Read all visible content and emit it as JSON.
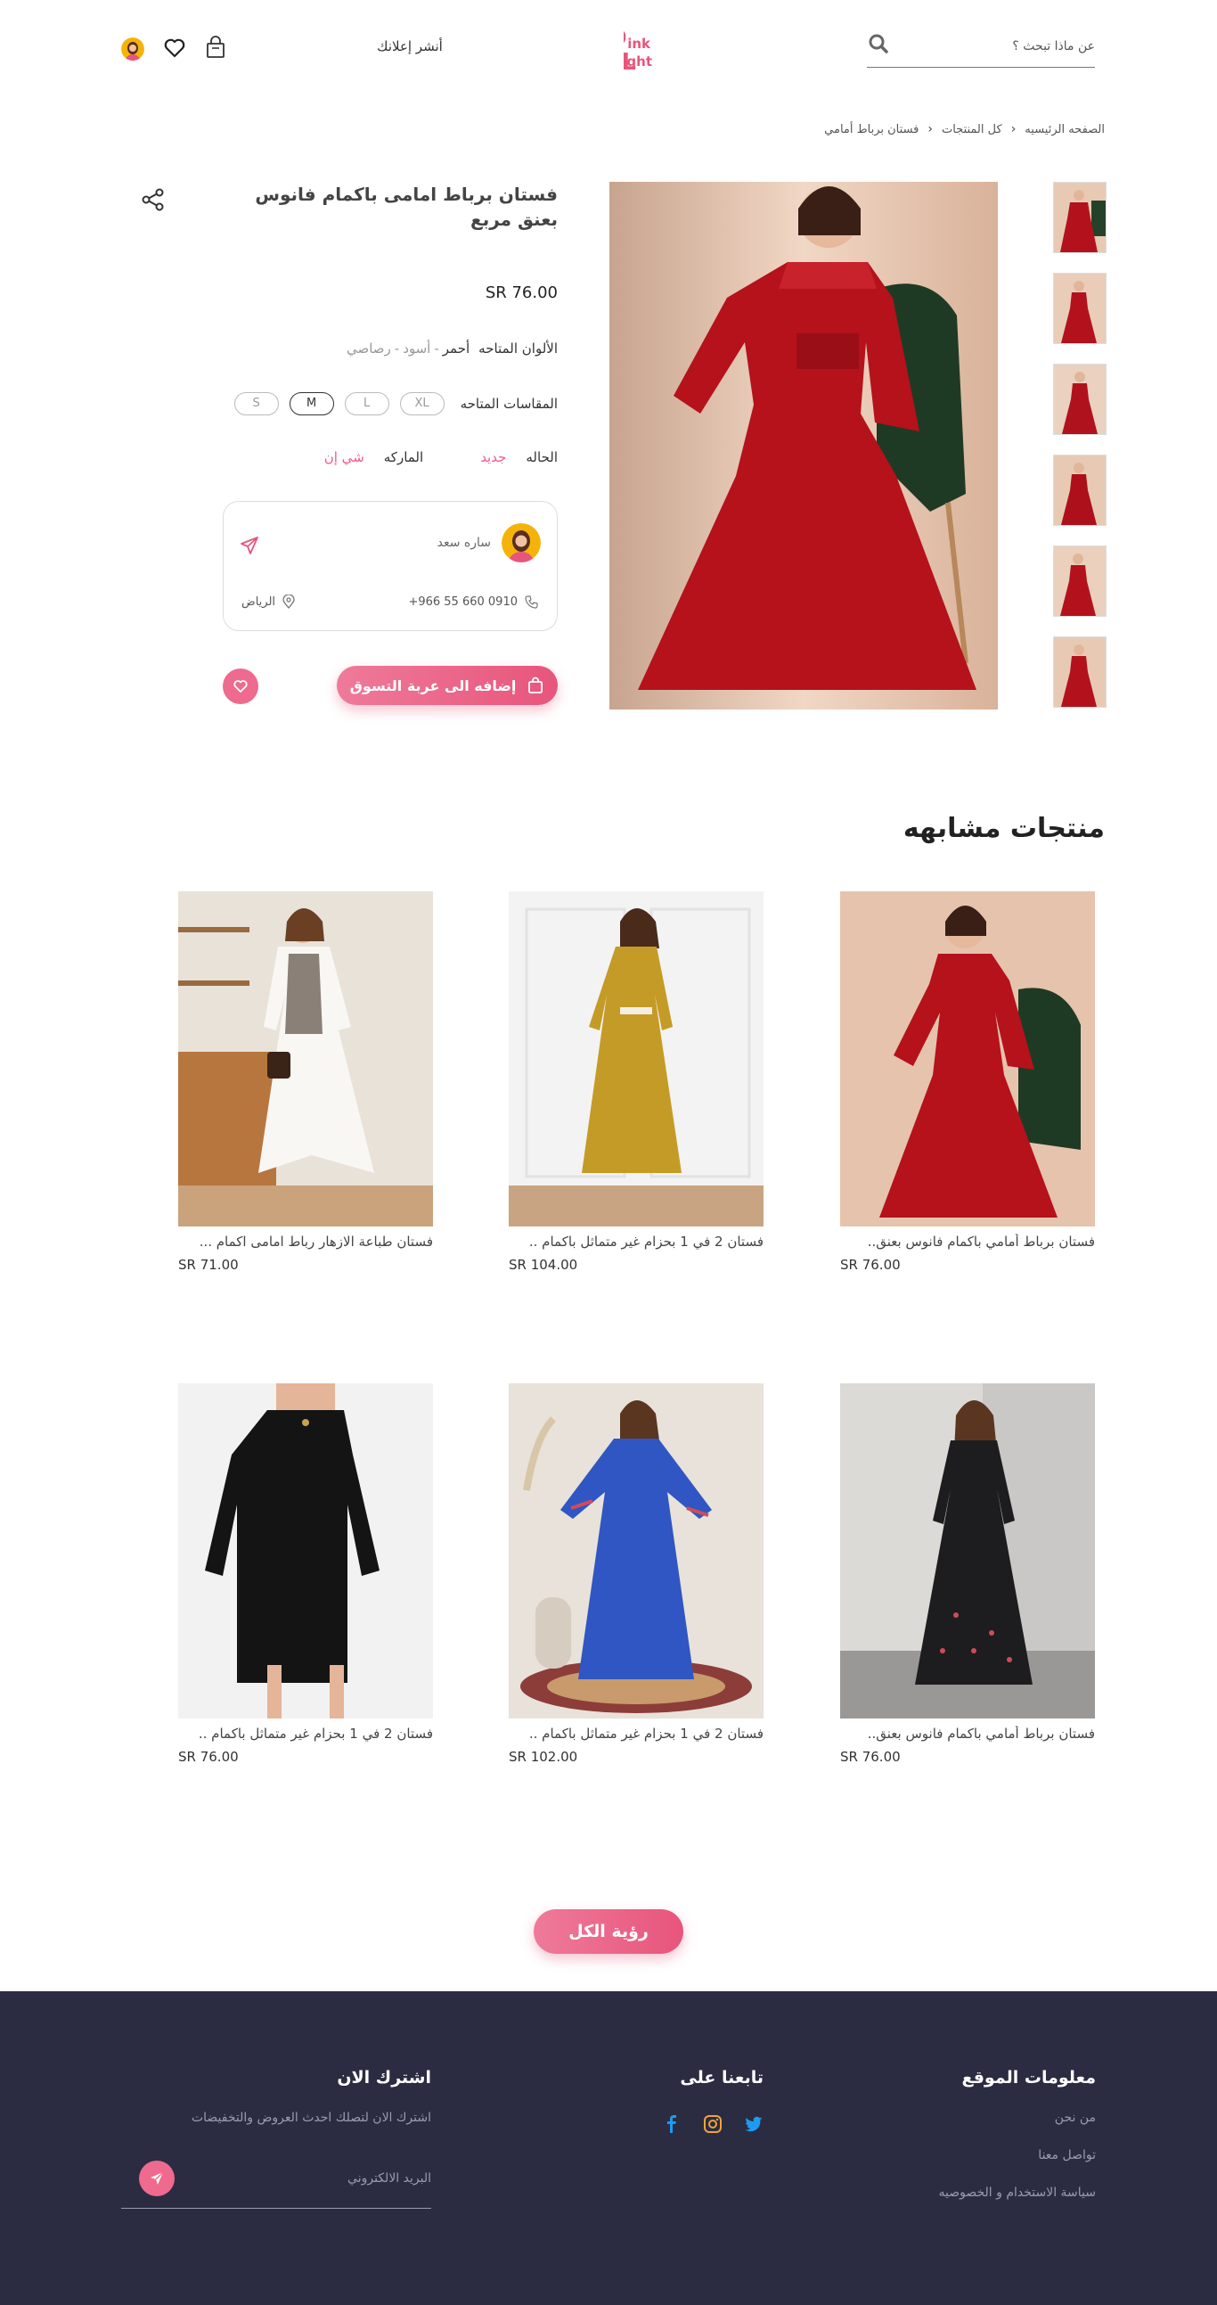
{
  "header": {
    "search_placeholder": "عن ماذا تبحث ؟",
    "logo_text_top": "ink",
    "logo_text_bottom": "ight",
    "advertise_label": "أنشر إعلانك",
    "brand_color": "#e8557c"
  },
  "breadcrumb": {
    "items": [
      "الصفحه الرئيسيه",
      "كل المنتجات",
      "فستان برباط أمامي"
    ]
  },
  "product": {
    "title": "فستان برباط امامى باكمام فانوس بعنق مربع",
    "price": "SR 76.00",
    "colors_label": "الألوان المتاحه",
    "colors": {
      "active": "أحمر",
      "sep1": "-",
      "c2": "أسود",
      "sep2": "-",
      "c3": "رصاصي"
    },
    "sizes_label": "المقاسات المتاحه",
    "sizes": [
      "XL",
      "L",
      "M",
      "S"
    ],
    "selected_size": "M",
    "condition_label": "الحاله",
    "condition_value": "جديد",
    "brand_label": "الماركه",
    "brand_value": "شي إن",
    "seller": {
      "name": "ساره سعد",
      "phone": "+966 55 660 0910",
      "city": "الرياض"
    },
    "add_to_cart_label": "إضافه الى عربة التسوق",
    "thumbnail_count": 6
  },
  "similar": {
    "title": "منتجات مشابهه",
    "items": [
      {
        "title": "فستان برباط أمامي باكمام فانوس بعنق..",
        "price": "SR 76.00",
        "tone": "red"
      },
      {
        "title": "فستان 2 في 1 بحزام غير متماثل باكمام ..",
        "price": "SR 104.00",
        "tone": "mustard"
      },
      {
        "title": "فستان طباعة الازهار رباط امامى اكمام ...",
        "price": "SR 71.00",
        "tone": "white"
      },
      {
        "title": "فستان برباط أمامي باكمام فانوس بعنق..",
        "price": "SR 76.00",
        "tone": "black"
      },
      {
        "title": "فستان 2 في 1 بحزام غير متماثل باكمام ..",
        "price": "SR 102.00",
        "tone": "blue"
      },
      {
        "title": "فستان 2 في 1 بحزام غير متماثل باكمام ..",
        "price": "SR 76.00",
        "tone": "black2"
      }
    ],
    "view_all_label": "رؤية الكل"
  },
  "footer": {
    "info_title": "معلومات الموقع",
    "info_links": [
      "من نحن",
      "تواصل معنا",
      "سياسة الاستخدام و الخصوصيه"
    ],
    "follow_title": "تابعنا على",
    "socials": [
      "twitter-icon",
      "instagram-icon",
      "facebook-icon"
    ],
    "subscribe_title": "اشترك الان",
    "subscribe_desc": "اشترك الان لتصلك احدث العروض والتخفيضات",
    "email_placeholder": "البريد الالكتروني",
    "bg_color": "#2b2c42"
  }
}
